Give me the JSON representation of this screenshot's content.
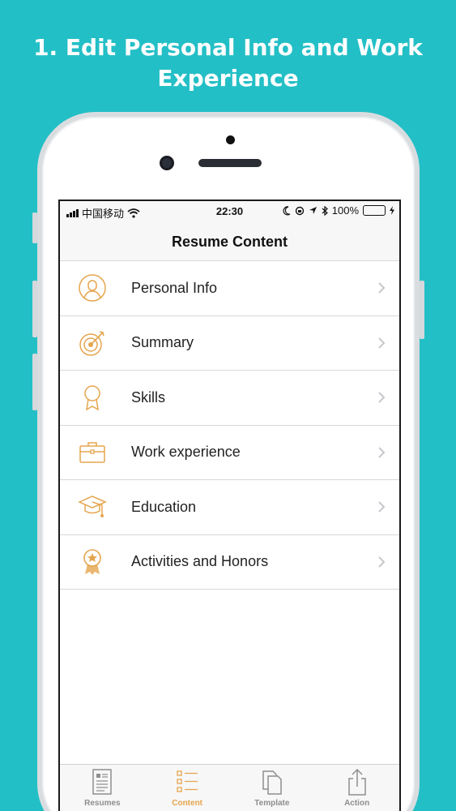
{
  "headline": {
    "line1": "1. Edit Personal Info and Work",
    "line2": "Experience"
  },
  "status_bar": {
    "carrier": "中国移动",
    "time": "22:30",
    "battery": "100%"
  },
  "nav": {
    "title": "Resume Content"
  },
  "items": [
    {
      "label": "Personal Info",
      "icon": "person-icon"
    },
    {
      "label": "Summary",
      "icon": "target-icon"
    },
    {
      "label": "Skills",
      "icon": "ribbon-icon"
    },
    {
      "label": "Work experience",
      "icon": "briefcase-icon"
    },
    {
      "label": "Education",
      "icon": "graduation-cap-icon"
    },
    {
      "label": "Activities and Honors",
      "icon": "medal-icon"
    }
  ],
  "tabs": [
    {
      "label": "Resumes",
      "icon": "document-icon",
      "active": false
    },
    {
      "label": "Content",
      "icon": "list-icon",
      "active": true
    },
    {
      "label": "Template",
      "icon": "copy-icon",
      "active": false
    },
    {
      "label": "Action",
      "icon": "share-icon",
      "active": false
    }
  ],
  "colors": {
    "background": "#23bfc6",
    "accent": "#e5a54e",
    "battery": "#4cd964"
  }
}
